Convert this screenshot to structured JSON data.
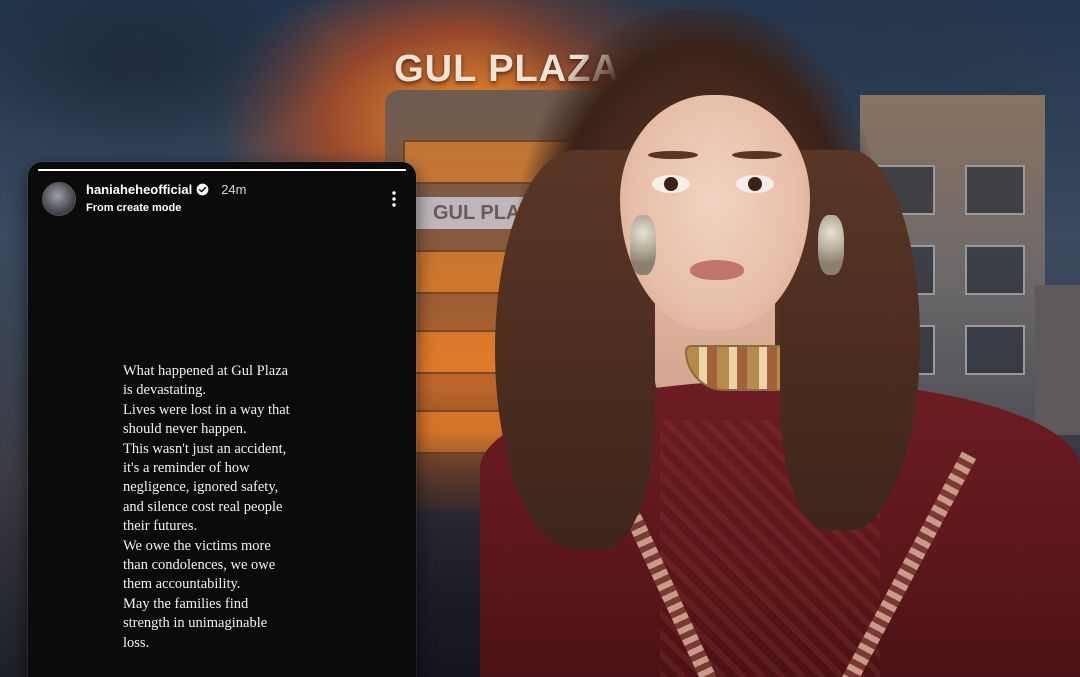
{
  "background": {
    "sign_top": "GUL PLAZA",
    "sign_mid": "GUL PLAZA"
  },
  "story": {
    "username": "haniaheheofficial",
    "verified": true,
    "time_ago": "24m",
    "subline": "From create mode",
    "progress": 1.0,
    "text": "What happened at Gul Plaza\nis devastating.\nLives were lost in a way that\nshould never happen.\nThis wasn't just an accident,\nit's a reminder of how\nnegligence, ignored safety,\nand silence cost real people\ntheir futures.\nWe owe the victims more\nthan condolences, we owe\nthem accountability.\nMay the families find\nstrength in unimaginable\nloss."
  },
  "colors": {
    "verified_badge": "#3897f0",
    "story_bg": "#0b0b0b"
  },
  "icons": {
    "more": "more-vertical-icon",
    "verified": "verified-badge-icon"
  }
}
